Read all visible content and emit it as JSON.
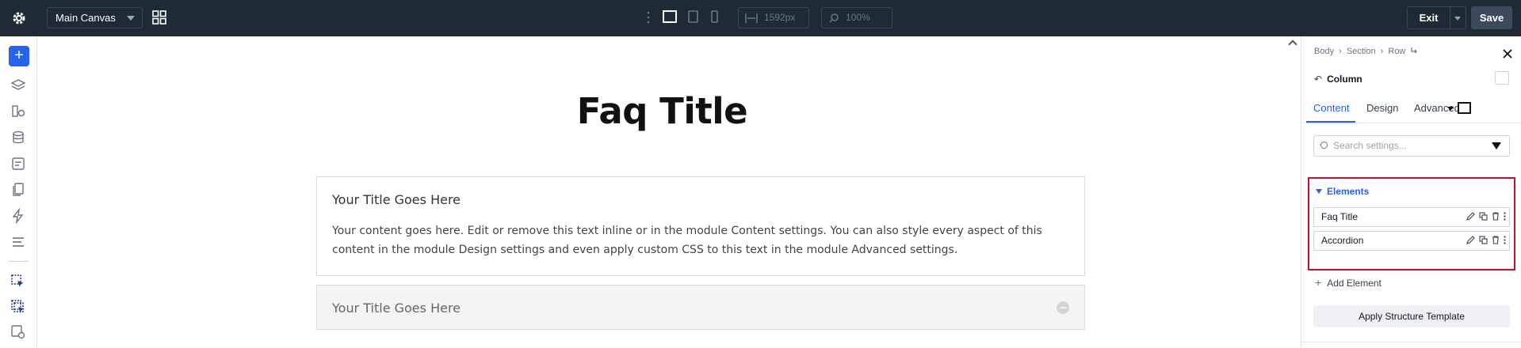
{
  "topbar": {
    "canvas_select": "Main Canvas",
    "width_value": "1592px",
    "zoom_value": "100%",
    "exit_label": "Exit",
    "save_label": "Save"
  },
  "canvas": {
    "heading": "Faq Title",
    "accordion": [
      {
        "title": "Your Title Goes Here",
        "body": "Your content goes here. Edit or remove this text inline or in the module Content settings. You can also style every aspect of this content in the module Design settings and even apply custom CSS to this text in the module Advanced settings.",
        "open": true
      },
      {
        "title": "Your Title Goes Here",
        "open": false
      }
    ]
  },
  "panel": {
    "breadcrumb": [
      "Body",
      "Section",
      "Row"
    ],
    "breadcrumb_sep": "›",
    "element_name": "Column",
    "tabs": [
      "Content",
      "Design",
      "Advanced"
    ],
    "active_tab": "Content",
    "search_placeholder": "Search settings...",
    "elements_header": "Elements",
    "elements": [
      "Faq Title",
      "Accordion"
    ],
    "add_element": "Add Element",
    "apply_template": "Apply Structure Template"
  },
  "colors": {
    "topbar_bg": "#1f2a37",
    "accent": "#2563eb",
    "highlight_border": "#c8102e"
  }
}
